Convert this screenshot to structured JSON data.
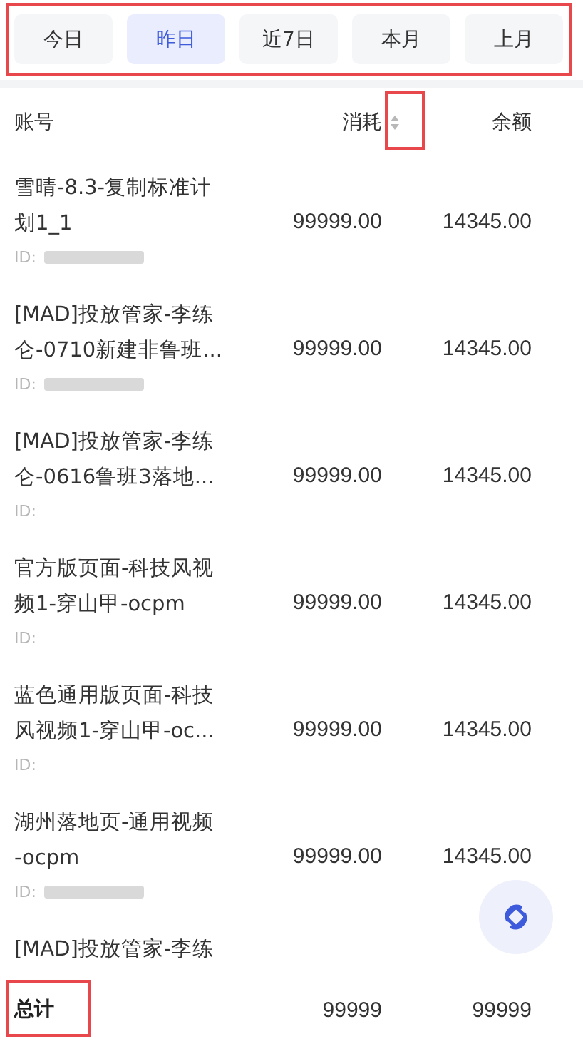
{
  "tabs": [
    {
      "label": "今日",
      "selected": false
    },
    {
      "label": "昨日",
      "selected": true
    },
    {
      "label": "近7日",
      "selected": false
    },
    {
      "label": "本月",
      "selected": false
    },
    {
      "label": "上月",
      "selected": false
    }
  ],
  "table": {
    "columns": [
      {
        "label": "账号",
        "sortable": false
      },
      {
        "label": "消耗",
        "sortable": true
      },
      {
        "label": "余额",
        "sortable": false
      }
    ],
    "rows": [
      {
        "name_lines": [
          "雪晴-8.3-复制标准计",
          "划1_1"
        ],
        "id": "ID:",
        "redacted": true,
        "cost": "99999.00",
        "balance": "14345.00"
      },
      {
        "name_lines": [
          "[MAD]投放管家-李练",
          "仑-0710新建非鲁班..."
        ],
        "id": "ID:",
        "redacted": true,
        "cost": "99999.00",
        "balance": "14345.00"
      },
      {
        "name_lines": [
          "[MAD]投放管家-李练",
          "仑-0616鲁班3落地..."
        ],
        "id": "ID:",
        "redacted": false,
        "cost": "99999.00",
        "balance": "14345.00"
      },
      {
        "name_lines": [
          "官方版页面-科技风视",
          "频1-穿山甲-ocpm"
        ],
        "id": "ID:",
        "redacted": false,
        "cost": "99999.00",
        "balance": "14345.00"
      },
      {
        "name_lines": [
          "蓝色通用版页面-科技",
          "风视频1-穿山甲-oc..."
        ],
        "id": "ID:",
        "redacted": false,
        "cost": "99999.00",
        "balance": "14345.00"
      },
      {
        "name_lines": [
          "湖州落地页-通用视频",
          "-ocpm"
        ],
        "id": "ID:",
        "redacted": true,
        "cost": "99999.00",
        "balance": "14345.00"
      },
      {
        "name_lines": [
          "[MAD]投放管家-李练"
        ]
      }
    ]
  },
  "total": {
    "label": "总计",
    "cost": "99999",
    "balance": "99999"
  }
}
